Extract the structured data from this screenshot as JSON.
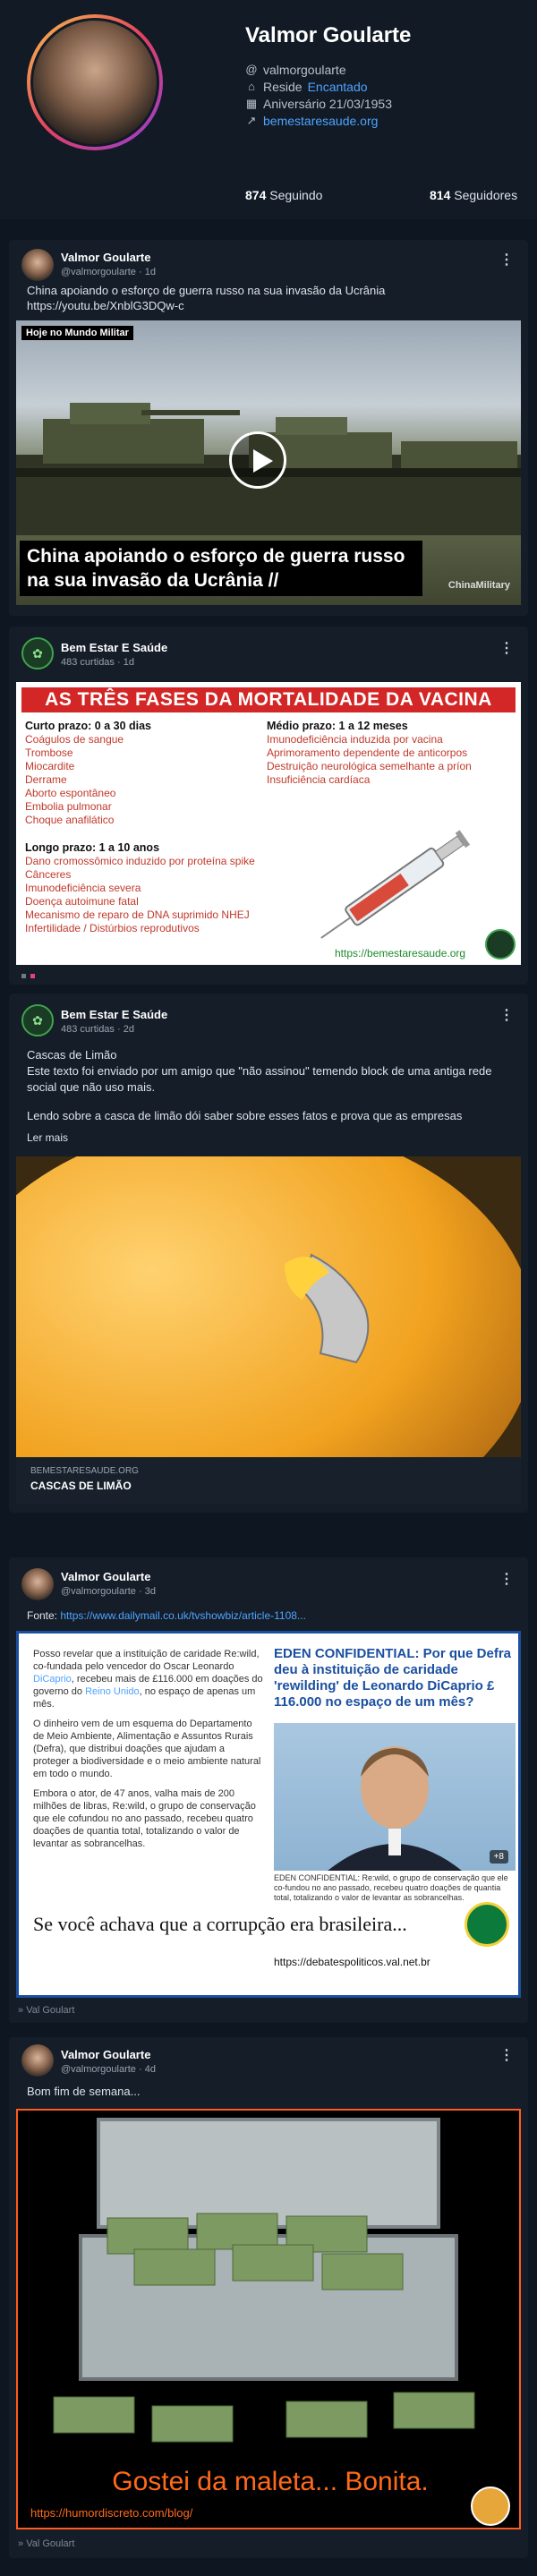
{
  "profile": {
    "name": "Valmor Goularte",
    "handle": "valmorgoularte",
    "lives_prefix": "Reside",
    "lives_city": "Encantado",
    "birthday": "Aniversário 21/03/1953",
    "website": "bemestaresaude.org",
    "following_count": "874",
    "following_label": "Seguindo",
    "followers_count": "814",
    "followers_label": "Seguidores"
  },
  "posts": [
    {
      "author": "Valmor Goularte",
      "sub": "@valmorgoularte",
      "time": "1d",
      "text": "China apoiando o esforço de guerra russo na sua invasão da Ucrânia",
      "link": "https://youtu.be/XnblG3DQw-c",
      "video_tag": "Hoje no Mundo Militar",
      "video_caption": "China apoiando o esforço de guerra russo na sua invasão da Ucrânia //",
      "video_watermark": "ChinaMilitary"
    },
    {
      "author": "Bem Estar E Saúde",
      "sub": "483 curtidas",
      "time": "1d",
      "infographic": {
        "title": "AS TRÊS FASES DA MORTALIDADE DA VACINA",
        "short_head": "Curto prazo: 0 a 30 dias",
        "short_items": [
          "Coágulos de sangue",
          "Trombose",
          "Miocardite",
          "Derrame",
          "Aborto espontâneo",
          "Embolia pulmonar",
          "Choque anafilático"
        ],
        "medium_head": "Médio prazo: 1 a 12 meses",
        "medium_items": [
          "Imunodeficiência induzida por vacina",
          "Aprimoramento dependente de anticorpos",
          "Destruição neurológica semelhante a príon",
          "Insuficiência cardíaca"
        ],
        "long_head": "Longo prazo: 1 a 10 anos",
        "long_items": [
          "Dano cromossômico induzido por proteína spike",
          "Cânceres",
          "Imunodeficiência severa",
          "Doença autoimune fatal",
          "Mecanismo de reparo de DNA suprimido NHEJ",
          "Infertilidade / Distúrbios reprodutivos"
        ],
        "footer": "https://bemestaresaude.org"
      }
    },
    {
      "author": "Bem Estar E Saúde",
      "sub": "483 curtidas",
      "time": "2d",
      "title": "Cascas de Limão",
      "body1": "Este texto foi enviado por um amigo que \"não assinou\" temendo block de uma antiga rede social que não uso mais.",
      "body2": "Lendo sobre a casca de limão dói saber sobre esses fatos e prova que as empresas",
      "more": "Ler mais",
      "card_domain": "BEMESTARESAUDE.ORG",
      "card_title": "CASCAS DE LIMÃO"
    },
    {
      "author": "Valmor Goularte",
      "sub": "@valmorgoularte",
      "time": "3d",
      "source_label": "Fonte:",
      "source_link": "https://www.dailymail.co.uk/tvshowbiz/article-1108...",
      "article": {
        "p1a": "Posso revelar que a instituição de caridade Re:wild, co-fundada pelo vencedor do Oscar Leonardo ",
        "p1b": "DiCaprio",
        "p1c": ", recebeu mais de £116.000 em doações do governo do ",
        "p1d": "Reino Unido",
        "p1e": ", no espaço de apenas um mês.",
        "p2": "O dinheiro vem de um esquema do Departamento de Meio Ambiente, Alimentação e Assuntos Rurais (Defra), que distribui doações que ajudam a proteger a biodiversidade e o meio ambiente natural em todo o mundo.",
        "p3": "Embora o ator, de 47 anos, valha mais de 200 milhões de libras, Re:wild, o grupo de conservação que ele cofundou no ano passado, recebeu quatro doações de quantia total, totalizando o valor de levantar as sobrancelhas.",
        "title": "EDEN CONFIDENTIAL: Por que Defra deu à instituição de caridade 'rewilding' de Leonardo DiCaprio £ 116.000 no espaço de um mês?",
        "photo_count": "+8",
        "caption": "EDEN CONFIDENTIAL: Re:wild, o grupo de conservação que ele co-fundou no ano passado, recebeu quatro doações de quantia total, totalizando o valor de levantar as sobrancelhas.",
        "big_line": "Se você achava que a corrupção era brasileira...",
        "site": "https://debatespoliticos.val.net.br"
      },
      "via": "Val Goulart"
    },
    {
      "author": "Valmor Goularte",
      "sub": "@valmorgoularte",
      "time": "4d",
      "text": "Bom fim de semana...",
      "caption": "Gostei da maleta... Bonita.",
      "url": "https://humordiscreto.com/blog/",
      "via": "Val Goulart"
    }
  ],
  "icons": {
    "at": "@",
    "home": "⌂",
    "calendar": "▦",
    "link": "↗",
    "more": "⋮",
    "via": "»"
  }
}
